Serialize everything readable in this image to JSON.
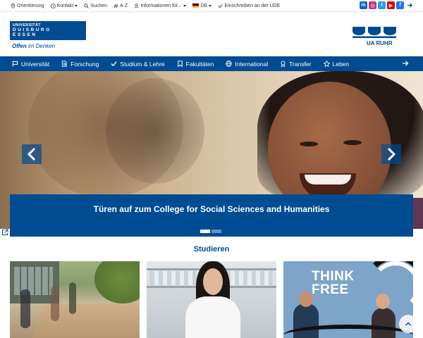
{
  "topbar": {
    "orientierung": "Orientierung",
    "kontakt": "Kontakt",
    "suchen": "Suchen",
    "az": "A-Z",
    "informationen": "Informationen für...",
    "language": "DE",
    "einschreiben": "Einschreiben an der UDE",
    "social": [
      "linkedin-icon",
      "instagram-icon",
      "twitter-icon",
      "youtube-icon",
      "facebook-icon"
    ]
  },
  "header": {
    "logo_line1": "UNIVERSITÄT",
    "logo_line2": "DUISBURG",
    "logo_line3": "ESSEN",
    "tagline_bold": "Offen",
    "tagline_rest": "im Denken",
    "partner_logo_text": "UA RUHR"
  },
  "nav": {
    "items": [
      {
        "label": "Universität",
        "icon": "flag-icon"
      },
      {
        "label": "Forschung",
        "icon": "document-search-icon"
      },
      {
        "label": "Studium & Lehre",
        "icon": "check-icon"
      },
      {
        "label": "Fakultäten",
        "icon": "bookmark-icon"
      },
      {
        "label": "International",
        "icon": "globe-icon"
      },
      {
        "label": "Transfer",
        "icon": "award-icon"
      },
      {
        "label": "Leben",
        "icon": "star-icon"
      }
    ]
  },
  "hero": {
    "caption": "Türen auf zum College for Social Sciences and Humanities",
    "slides_total": 2,
    "active_slide": 1
  },
  "section": {
    "title": "Studieren"
  },
  "cards": {
    "card3_text_line1": "THINK",
    "card3_text_line2": "FREE"
  },
  "colors": {
    "brand_blue": "#004c93",
    "white": "#ffffff"
  }
}
